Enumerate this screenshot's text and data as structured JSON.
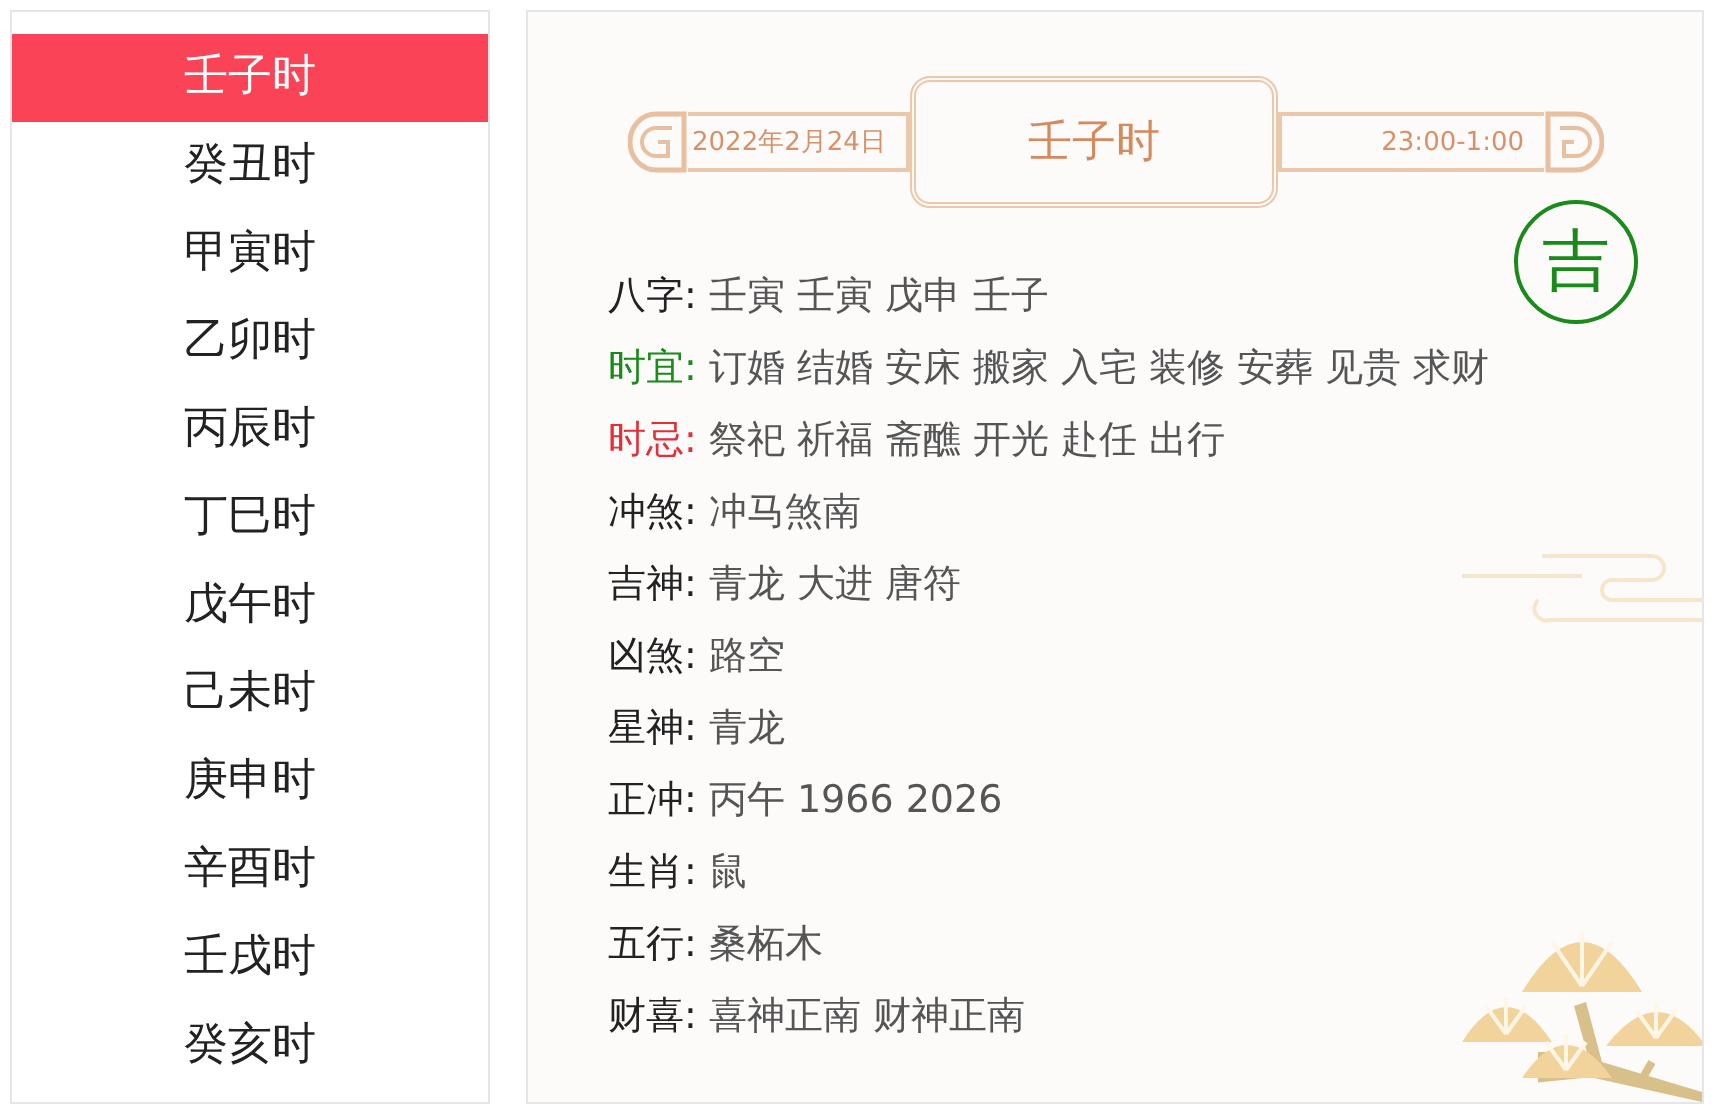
{
  "sidebar": {
    "items": [
      {
        "label": "壬子时",
        "selected": true
      },
      {
        "label": "癸丑时",
        "selected": false
      },
      {
        "label": "甲寅时",
        "selected": false
      },
      {
        "label": "乙卯时",
        "selected": false
      },
      {
        "label": "丙辰时",
        "selected": false
      },
      {
        "label": "丁巳时",
        "selected": false
      },
      {
        "label": "戊午时",
        "selected": false
      },
      {
        "label": "己未时",
        "selected": false
      },
      {
        "label": "庚申时",
        "selected": false
      },
      {
        "label": "辛酉时",
        "selected": false
      },
      {
        "label": "壬戌时",
        "selected": false
      },
      {
        "label": "癸亥时",
        "selected": false
      }
    ]
  },
  "banner": {
    "date": "2022年2月24日",
    "title": "壬子时",
    "time": "23:00-1:00"
  },
  "luck_badge": {
    "text": "吉",
    "kind": "good"
  },
  "details": [
    {
      "label": "八字:",
      "value": "壬寅 壬寅 戊申 壬子",
      "kind": "normal"
    },
    {
      "label": "时宜:",
      "value": "订婚 结婚 安床 搬家 入宅 装修 安葬 见贵 求财",
      "kind": "good"
    },
    {
      "label": "时忌:",
      "value": "祭祀 祈福 斋醮 开光 赴任 出行",
      "kind": "bad"
    },
    {
      "label": "冲煞:",
      "value": "冲马煞南",
      "kind": "normal"
    },
    {
      "label": "吉神:",
      "value": "青龙 大进 唐符",
      "kind": "normal"
    },
    {
      "label": "凶煞:",
      "value": "路空",
      "kind": "normal"
    },
    {
      "label": "星神:",
      "value": "青龙",
      "kind": "normal"
    },
    {
      "label": "正冲:",
      "value": "丙午 1966 2026",
      "kind": "normal"
    },
    {
      "label": "生肖:",
      "value": "鼠",
      "kind": "normal"
    },
    {
      "label": "五行:",
      "value": "桑柘木",
      "kind": "normal"
    },
    {
      "label": "财喜:",
      "value": "喜神正南 财神正南",
      "kind": "normal"
    }
  ]
}
